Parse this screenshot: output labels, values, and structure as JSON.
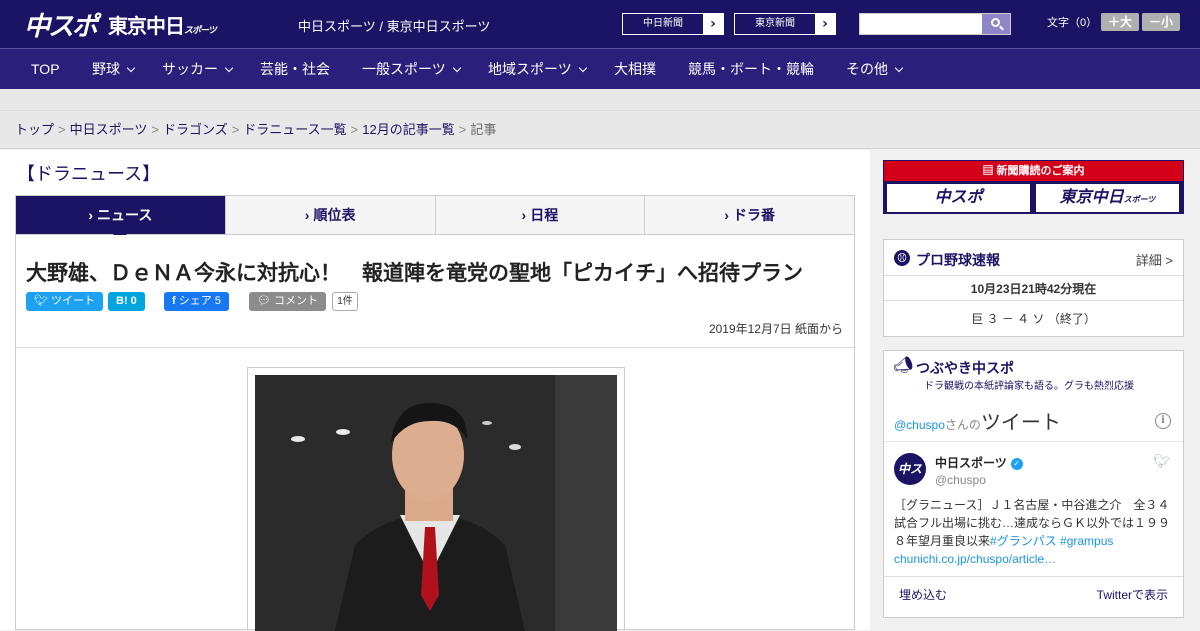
{
  "header": {
    "logo_chuspo": "中スポ",
    "logo_tokyo": "東京中日",
    "logo_tokyo_sub": "スポーツ",
    "site_name": "中日スポーツ / 東京中日スポーツ",
    "paper_link_1": "中日新聞",
    "paper_link_2": "東京新聞",
    "search_placeholder": "",
    "font_size_label": "文字（0）",
    "font_bigger": "＋大",
    "font_smaller": "－小"
  },
  "nav": {
    "items": [
      {
        "label": "TOP"
      },
      {
        "label": "野球"
      },
      {
        "label": "サッカー"
      },
      {
        "label": "芸能・社会"
      },
      {
        "label": "一般スポーツ"
      },
      {
        "label": "地域スポーツ"
      },
      {
        "label": "大相撲"
      },
      {
        "label": "競馬・ボート・競輪"
      },
      {
        "label": "その他"
      }
    ]
  },
  "breadcrumb": {
    "items": [
      "トップ",
      "中日スポーツ",
      "ドラゴンズ",
      "ドラニュース一覧",
      "12月の記事一覧"
    ],
    "current": "記事",
    "separator": ">"
  },
  "section": {
    "title": "【ドラニュース】",
    "tabs": [
      "ニュース",
      "順位表",
      "日程",
      "ドラ番"
    ],
    "tab_glyph": "›"
  },
  "article": {
    "headline": "大野雄、ＤｅＮＡ今永に対抗心！　報道陣を竜党の聖地「ピカイチ」へ招待プラン",
    "share": {
      "tweet": "ツイート",
      "hatena": "B!",
      "hatena_count": "0",
      "facebook": "シェア",
      "facebook_count": "5",
      "comment": "コメント",
      "comment_count": "1件"
    },
    "date": "2019年12月7日 紙面から"
  },
  "sidebar": {
    "subscription": {
      "header": "新聞購読のご案内",
      "brand_1": "中スポ",
      "brand_2": "東京中日",
      "brand_2_sub": "スポーツ"
    },
    "baseball": {
      "title": "プロ野球速報",
      "more": "詳細 >",
      "timestamp": "10月23日21時42分現在",
      "score": "巨 ３ － ４ ソ （終了）"
    },
    "twitter": {
      "title": "つぶやき中スポ",
      "subtitle": "ドラ観戦の本紙評論家も語る。グラも熱烈応援",
      "handle_prefix": "@chuspo",
      "handle_mid": "さんの",
      "heading": "ツイート",
      "info_glyph": "i",
      "avatar_text": "中スポ",
      "account_name": "中日スポーツ",
      "account_handle": "@chuspo",
      "tweet_text": "［グラニュース］Ｊ１名古屋・中谷進之介　全３４試合フル出場に挑む…達成ならＧＫ以外では１９９８年望月重良以来",
      "tweet_hashtags": "#グランパス #grampus",
      "tweet_link": "chunichi.co.jp/chuspo/article…",
      "embed": "埋め込む",
      "view_on_twitter": "Twitterで表示"
    }
  },
  "colors": {
    "brand_navy": "#1b1464",
    "nav_bg": "#2a1f7a",
    "accent_red": "#d4001a",
    "twitter_blue": "#1da1f2",
    "hatena_blue": "#00a4de",
    "facebook_blue": "#1877f2",
    "comment_gray": "#8c8c8c"
  }
}
